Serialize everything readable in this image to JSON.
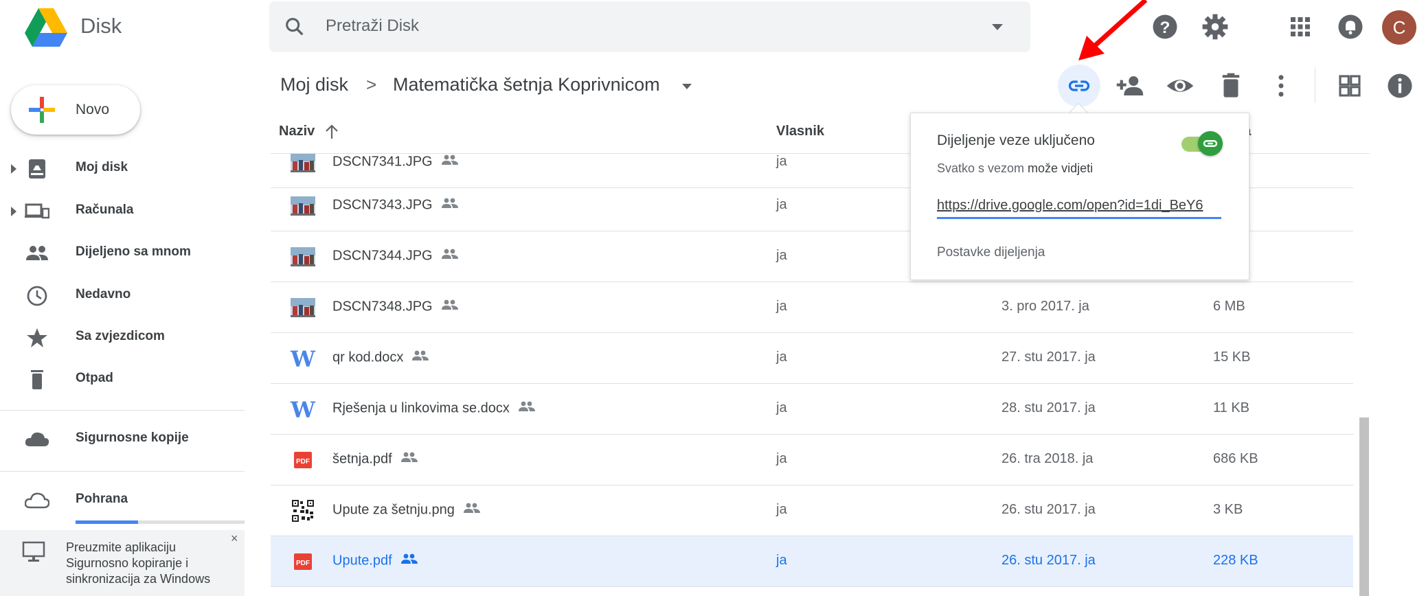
{
  "app": {
    "name": "Disk"
  },
  "search": {
    "placeholder": "Pretraži Disk"
  },
  "header": {
    "avatar_letter": "C"
  },
  "sidebar": {
    "new_label": "Novo",
    "items": [
      {
        "label": "Moj disk",
        "icon": "drive-icon"
      },
      {
        "label": "Računala",
        "icon": "computer-icon"
      },
      {
        "label": "Dijeljeno sa mnom",
        "icon": "people-icon"
      },
      {
        "label": "Nedavno",
        "icon": "clock-icon"
      },
      {
        "label": "Sa zvjezdicom",
        "icon": "star-icon"
      },
      {
        "label": "Otpad",
        "icon": "trash-icon"
      },
      {
        "label": "Sigurnosne kopije",
        "icon": "cloud-icon"
      },
      {
        "label": "Pohrana",
        "icon": "cloud-outline-icon"
      }
    ],
    "storage_fraction": 0.37,
    "promo": {
      "text": "Preuzmite aplikaciju Sigurnosno kopiranje i sinkronizacija za Windows",
      "close": "×"
    }
  },
  "breadcrumb": {
    "root": "Moj disk",
    "separator": ">",
    "folder": "Matematička šetnja Koprivnicom"
  },
  "table": {
    "headers": {
      "name": "Naziv",
      "owner": "Vlasnik",
      "size_partial": "na"
    },
    "rows": [
      {
        "name": "DSCN7341.JPG",
        "type": "image",
        "owner": "ja",
        "modified": "",
        "size": "",
        "selected": false
      },
      {
        "name": "DSCN7343.JPG",
        "type": "image",
        "owner": "ja",
        "modified": "",
        "size": "",
        "selected": false
      },
      {
        "name": "DSCN7344.JPG",
        "type": "image",
        "owner": "ja",
        "modified": "",
        "size": "",
        "selected": false
      },
      {
        "name": "DSCN7348.JPG",
        "type": "image",
        "owner": "ja",
        "modified": "3. pro 2017. ja",
        "size": "6 MB",
        "selected": false
      },
      {
        "name": "qr kod.docx",
        "type": "word",
        "owner": "ja",
        "modified": "27. stu 2017. ja",
        "size": "15 KB",
        "selected": false
      },
      {
        "name": "Rješenja u linkovima se.docx",
        "type": "word",
        "owner": "ja",
        "modified": "28. stu 2017. ja",
        "size": "11 KB",
        "selected": false
      },
      {
        "name": "šetnja.pdf",
        "type": "pdf",
        "owner": "ja",
        "modified": "26. tra 2018. ja",
        "size": "686 KB",
        "selected": false
      },
      {
        "name": "Upute za šetnju.png",
        "type": "qr",
        "owner": "ja",
        "modified": "26. stu 2017. ja",
        "size": "3 KB",
        "selected": false
      },
      {
        "name": "Upute.pdf",
        "type": "pdf",
        "owner": "ja",
        "modified": "26. stu 2017. ja",
        "size": "228 KB",
        "selected": true
      }
    ]
  },
  "share_popup": {
    "title": "Dijeljenje veze uključeno",
    "subtitle_prefix": "Svatko s vezom ",
    "subtitle_bold": "može vidjeti",
    "url": "https://drive.google.com/open?id=1di_BeY6",
    "settings_link": "Postavke dijeljenja",
    "toggle_on": true
  },
  "colors": {
    "accent": "#1a73e8",
    "selected_row": "#e8f0fe",
    "toggle": "#2e9e3e",
    "annotation_arrow": "#ff0000"
  }
}
